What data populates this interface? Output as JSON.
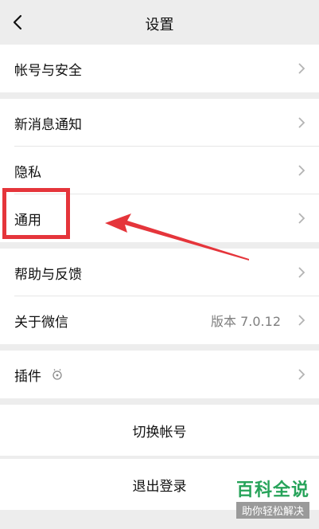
{
  "header": {
    "title": "设置"
  },
  "groups": {
    "account": {
      "label": "帐号与安全"
    },
    "notify": {
      "label": "新消息通知"
    },
    "privacy": {
      "label": "隐私"
    },
    "general": {
      "label": "通用"
    },
    "help": {
      "label": "帮助与反馈"
    },
    "about": {
      "label": "关于微信",
      "value": "版本 7.0.12"
    },
    "plugins": {
      "label": "插件"
    }
  },
  "actions": {
    "switch_account": "切换帐号",
    "logout": "退出登录"
  },
  "watermark": {
    "title": "百科全说",
    "subtitle": "助你轻松解决"
  },
  "colors": {
    "annotation": "#e5353b",
    "background": "#ededed",
    "watermark": "#27a35a"
  },
  "icons": [
    "back-arrow-icon",
    "chevron-right-icon",
    "plugin-icon"
  ]
}
